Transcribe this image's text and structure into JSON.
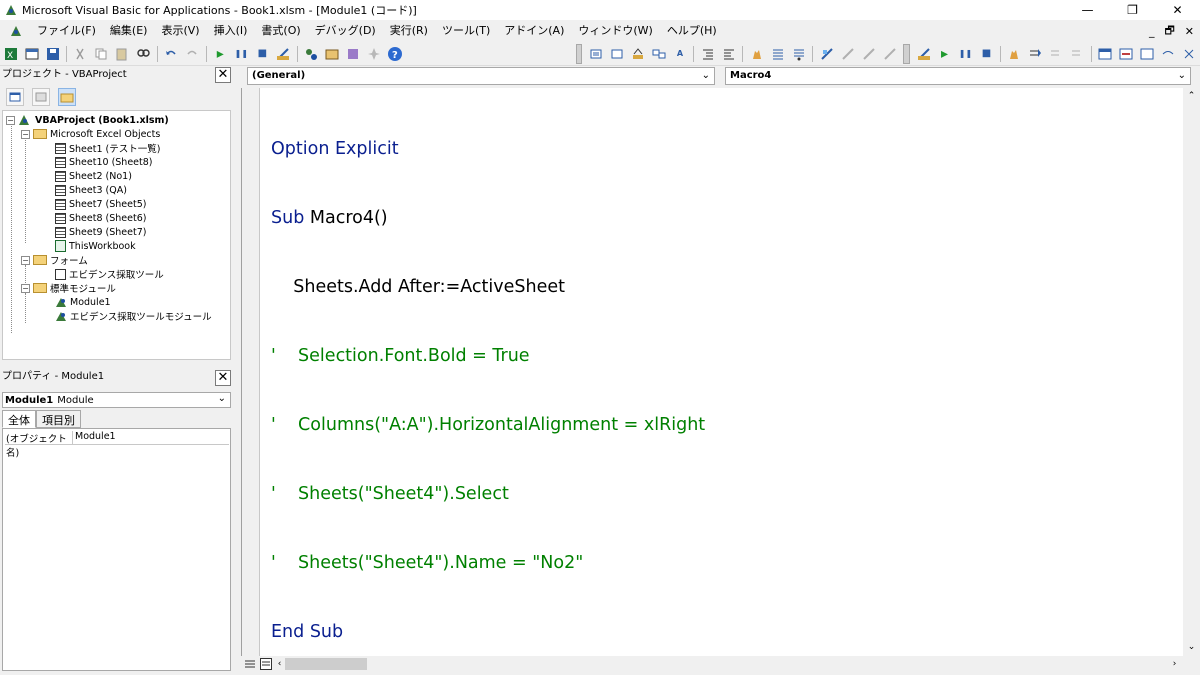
{
  "window": {
    "title": "Microsoft Visual Basic for Applications - Book1.xlsm - [Module1 (コード)]",
    "minimize": "—",
    "restore": "❐",
    "close": "✕"
  },
  "menu": {
    "items": [
      "ファイル(F)",
      "編集(E)",
      "表示(V)",
      "挿入(I)",
      "書式(O)",
      "デバッグ(D)",
      "実行(R)",
      "ツール(T)",
      "アドイン(A)",
      "ウィンドウ(W)",
      "ヘルプ(H)"
    ],
    "mdi_minimize": "_",
    "mdi_restore": "🗗",
    "mdi_close": "✕"
  },
  "toolbar": {
    "run": "▸",
    "pause": "❚❚",
    "reset": "■",
    "help": "?"
  },
  "project": {
    "title": "プロジェクト - VBAProject",
    "close": "✕",
    "tree": {
      "root": "VBAProject (Book1.xlsm)",
      "excel_objects": "Microsoft Excel Objects",
      "sheets": [
        "Sheet1 (テスト一覧)",
        "Sheet10 (Sheet8)",
        "Sheet2 (No1)",
        "Sheet3 (QA)",
        "Sheet7 (Sheet5)",
        "Sheet8 (Sheet6)",
        "Sheet9 (Sheet7)"
      ],
      "workbook": "ThisWorkbook",
      "forms_folder": "フォーム",
      "forms": [
        "エビデンス採取ツール"
      ],
      "modules_folder": "標準モジュール",
      "modules": [
        "Module1",
        "エビデンス採取ツールモジュール"
      ]
    }
  },
  "properties": {
    "title": "プロパティ - Module1",
    "close": "✕",
    "object_bold": "Module1",
    "object_type": "Module",
    "tabs": [
      "全体",
      "項目別"
    ],
    "rows": [
      {
        "name": "(オブジェクト名)",
        "value": "Module1"
      }
    ]
  },
  "code": {
    "object_combo": "(General)",
    "procedure_combo": "Macro4",
    "lines": [
      {
        "kind": "kw",
        "text": "Option Explicit"
      },
      {
        "kind": "mixed",
        "kw": "Sub ",
        "rest": "Macro4()"
      },
      {
        "kind": "tx",
        "text": "    Sheets.Add After:=ActiveSheet"
      },
      {
        "kind": "cm",
        "text": "'    Selection.Font.Bold = True"
      },
      {
        "kind": "cm",
        "text": "'    Columns(\"A:A\").HorizontalAlignment = xlRight"
      },
      {
        "kind": "cm",
        "text": "'    Sheets(\"Sheet4\").Select"
      },
      {
        "kind": "cm",
        "text": "'    Sheets(\"Sheet4\").Name = \"No2\""
      },
      {
        "kind": "kw",
        "text": "End Sub"
      }
    ]
  },
  "colors": {
    "keyword": "#0a1f8f",
    "comment": "#008000",
    "text": "#000000"
  }
}
